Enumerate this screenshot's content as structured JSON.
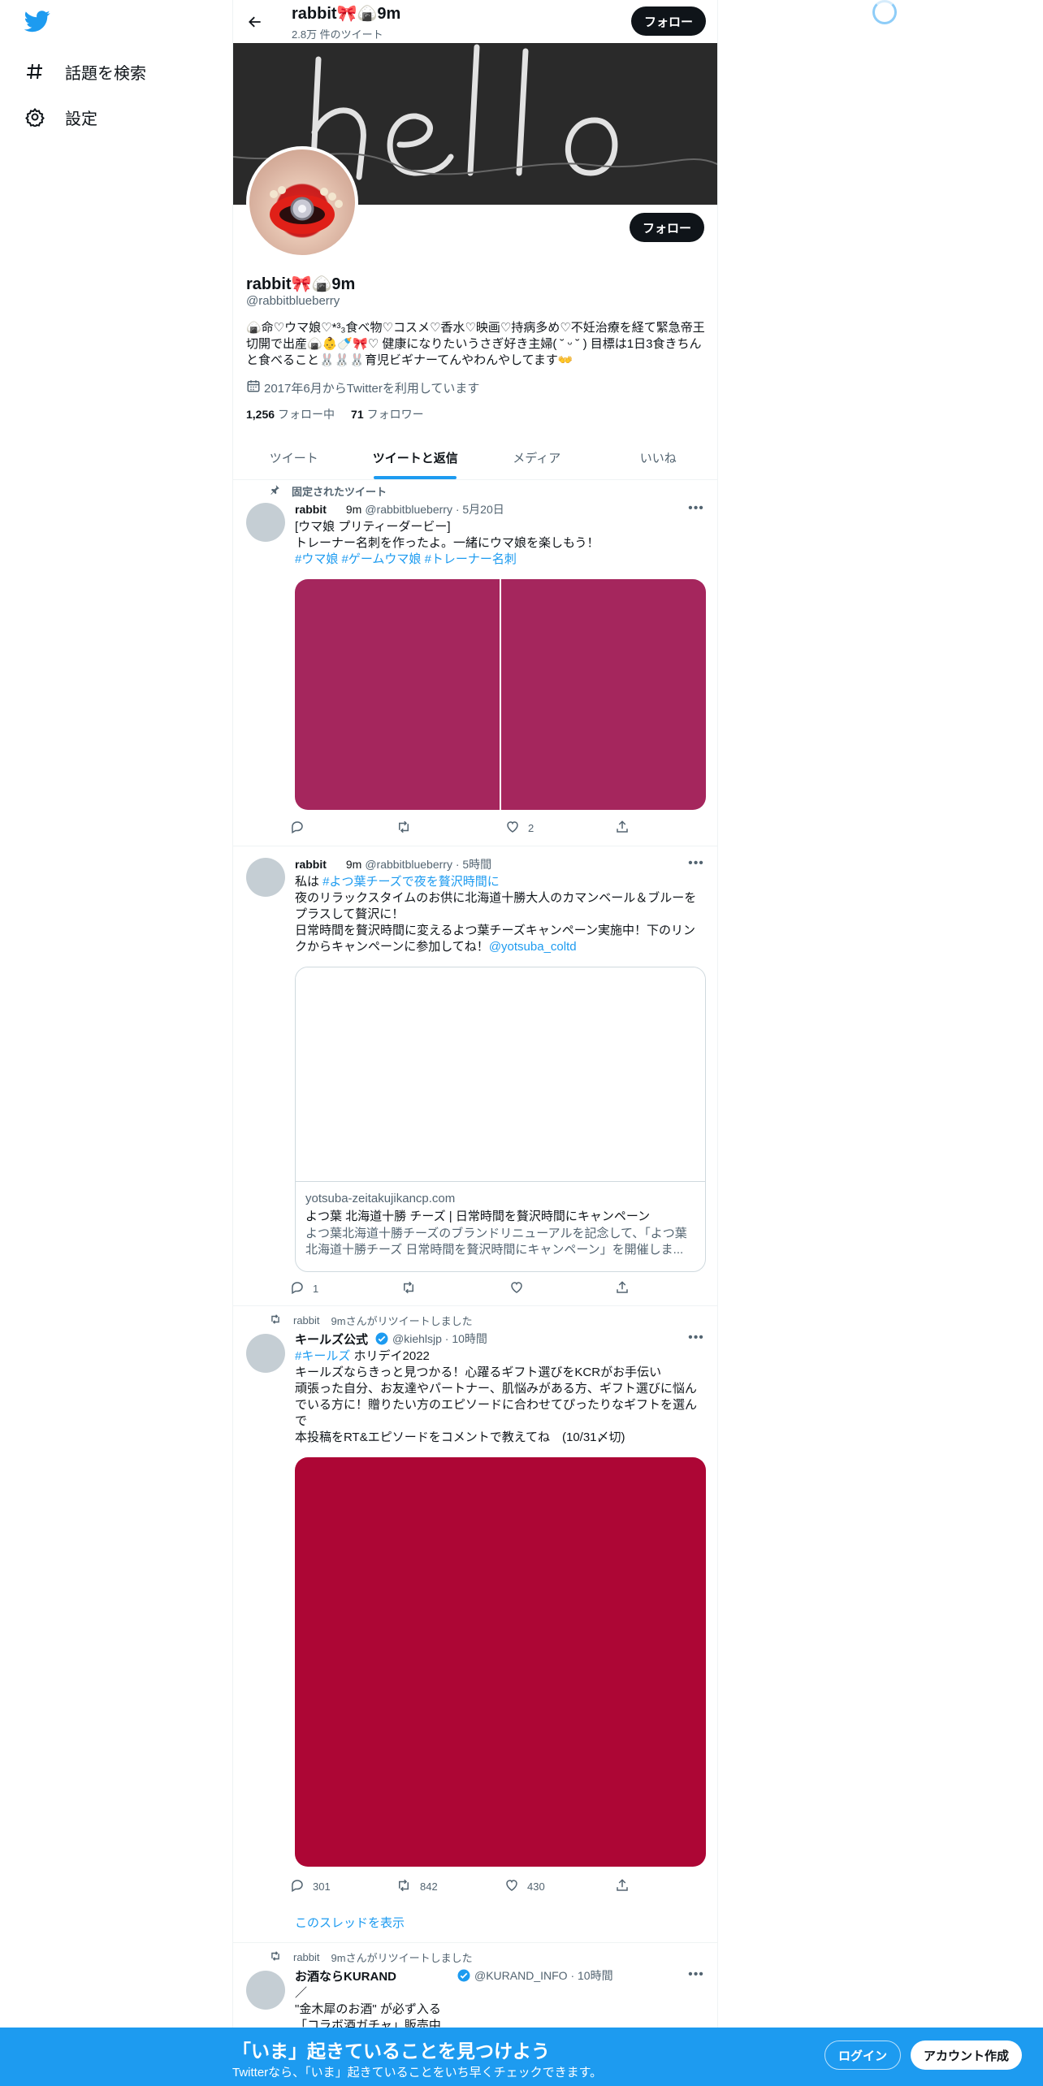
{
  "nav": {
    "explore_label": "話題を検索",
    "settings_label": "設定"
  },
  "header": {
    "name": "rabbit🎀🍙9m",
    "tweet_count": "2.8万 件のツイート",
    "follow_label": "フォロー"
  },
  "profile": {
    "name": "rabbit🎀🍙9m",
    "handle": "@rabbitblueberry",
    "bio": "🍙命♡ウマ娘♡*³₃食べ物♡コスメ♡香水♡映画♡持病多め♡不妊治療を経て緊急帝王切開で出産🍙👶🍼🎀♡ 健康になりたいうさぎ好き主婦( ˘ ᵕ ˘ ) 目標は1日3食きちんと食べること🐰🐰🐰育児ビギナーてんやわんやしてます👐",
    "joined": "2017年6月からTwitterを利用しています",
    "following_count": "1,256",
    "following_label": "フォロー中",
    "followers_count": "71",
    "followers_label": "フォロワー",
    "follow_label": "フォロー"
  },
  "tabs": [
    {
      "label": "ツイート"
    },
    {
      "label": "ツイートと返信"
    },
    {
      "label": "メディア"
    },
    {
      "label": "いいね"
    }
  ],
  "tweets": [
    {
      "context": "固定されたツイート",
      "name": "rabbit",
      "name_suffix": "9m",
      "handle_time": "@rabbitblueberry · 5月20日",
      "line1": "[ウマ娘 プリティーダービー]",
      "line2": "トレーナー名刺を作ったよ。一緒にウマ娘を楽しもう！",
      "hashtags": "#ウマ娘 #ゲームウマ娘 #トレーナー名刺",
      "media_color": "#a5265d",
      "reply_count": "",
      "retweet_count": "",
      "like_count": "2"
    },
    {
      "name": "rabbit",
      "name_suffix": "9m",
      "handle_time": "@rabbitblueberry · 5時間",
      "line1_prefix": "私は ",
      "line1_link": "#よつ葉チーズで夜を贅沢時間に",
      "line2": "夜のリラックスタイムのお供に北海道十勝大人のカマンベール＆ブルーをプラスして贅沢に！",
      "line3": "日常時間を贅沢時間に変えるよつ葉チーズキャンペーン実施中！下のリンクからキャンペーンに参加してね！",
      "mention": "@yotsuba_coltd",
      "card_domain": "yotsuba-zeitakujikancp.com",
      "card_title": "よつ葉 北海道十勝 チーズ | 日常時間を贅沢時間にキャンペーン",
      "card_desc": "よつ葉北海道十勝チーズのブランドリニューアルを記念して、「よつ葉 北海道十勝チーズ 日常時間を贅沢時間にキャンペーン」を開催しま...",
      "reply_count": "1",
      "retweet_count": "",
      "like_count": ""
    },
    {
      "context_name": "rabbit",
      "context_suffix": "9mさんがリツイートしました",
      "name": "キールズ公式",
      "handle_time": "@kiehlsjp · 10時間",
      "hashtag": "#キールズ",
      "line1_rest": " ホリデイ2022",
      "line2": "キールズならきっと見つかる！心躍るギフト選びをKCRがお手伝い",
      "line3": "頑張った自分、お友達やパートナー、肌悩みがある方、ギフト選びに悩んでいる方に！贈りたい方のエピソードに合わせてぴったりなギフトを選んで",
      "line4": "本投稿をRT&エピソードをコメントで教えてね　(10/31〆切)",
      "media_color": "#ad0635",
      "reply_count": "301",
      "retweet_count": "842",
      "like_count": "430",
      "show_thread": "このスレッドを表示"
    },
    {
      "context_name": "rabbit",
      "context_suffix": "9mさんがリツイートしました",
      "name": "お酒ならKURAND",
      "handle_time": "@KURAND_INFO · 10時間",
      "line1": "／",
      "line2": "\"金木犀のお酒\" が必ず入る",
      "line3": "「コラボ酒ガチャ」販売中"
    }
  ],
  "bottom_bar": {
    "title": "「いま」起きていることを見つけよう",
    "subtitle": "Twitterなら、「いま」起きていることをいち早くチェックできます。",
    "login_label": "ログイン",
    "signup_label": "アカウント作成"
  },
  "colors": {
    "accent": "#1d9bf0",
    "dark_button": "#0f1419",
    "secondary_text": "#536471"
  }
}
